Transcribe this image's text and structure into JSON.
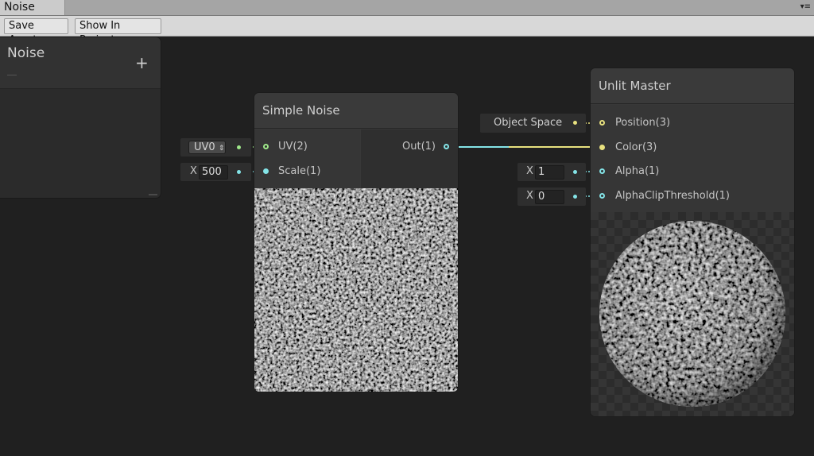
{
  "window": {
    "tab_title": "Noise",
    "tab_menu_icon": "▾≡"
  },
  "toolbar": {
    "save_label": "Save Asset",
    "show_label": "Show In Project"
  },
  "blackboard": {
    "title": "Noise",
    "add_icon": "+"
  },
  "simple_noise": {
    "title": "Simple Noise",
    "inputs": [
      {
        "label": "UV(2)"
      },
      {
        "label": "Scale(1)"
      }
    ],
    "output": {
      "label": "Out(1)"
    },
    "uv_field": {
      "value": "UV0",
      "stepper_icon": "⇕"
    },
    "scale_field": {
      "axis": "X",
      "value": "500"
    }
  },
  "unlit_master": {
    "title": "Unlit Master",
    "inputs": [
      {
        "label": "Position(3)"
      },
      {
        "label": "Color(3)"
      },
      {
        "label": "Alpha(1)"
      },
      {
        "label": "AlphaClipThreshold(1)"
      }
    ],
    "position_field": {
      "value": "Object Space"
    },
    "alpha_field": {
      "axis": "X",
      "value": "1"
    },
    "clip_field": {
      "axis": "X",
      "value": "0"
    }
  },
  "colors": {
    "vector_port": "#84e4e7",
    "uv_port": "#9fe88a",
    "color_port": "#e8e17f",
    "background": "#202020",
    "node": "#383838"
  }
}
